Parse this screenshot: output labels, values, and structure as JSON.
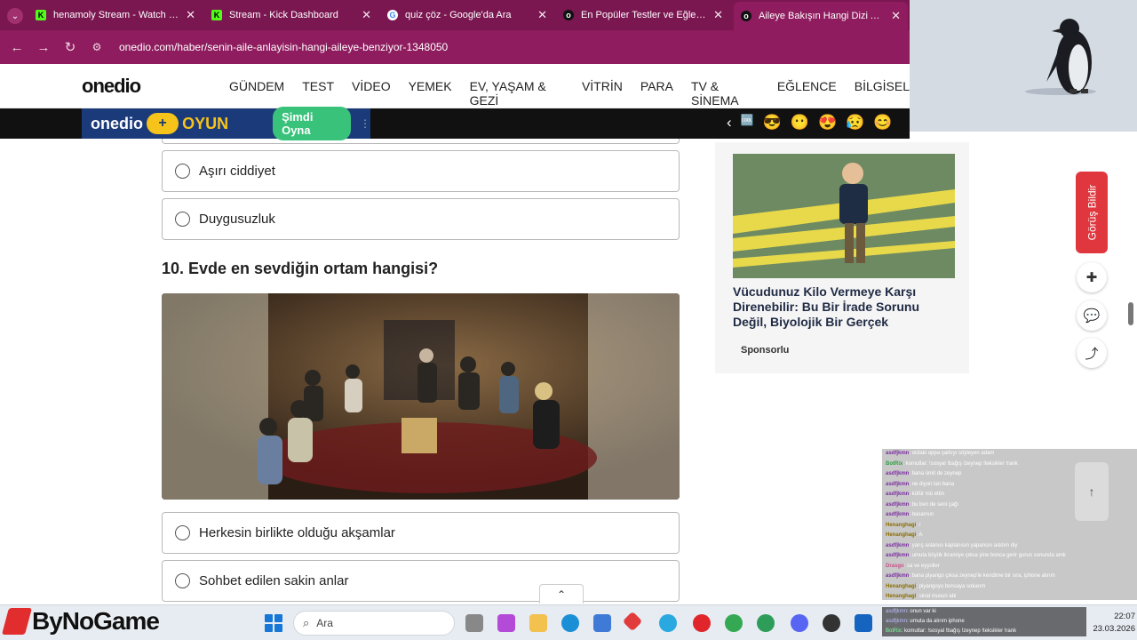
{
  "browser": {
    "tabs": [
      {
        "title": "henamoly Stream - Watch Live",
        "favicon": "K",
        "color": "#53fc18",
        "active": false
      },
      {
        "title": "Stream - Kick Dashboard",
        "favicon": "K",
        "color": "#53fc18",
        "active": false
      },
      {
        "title": "quiz çöz - Google'da Ara",
        "favicon": "G",
        "color": "#ffffff",
        "active": false
      },
      {
        "title": "En Popüler Testler ve Eğlenceli",
        "favicon": "o",
        "color": "#111111",
        "active": false
      },
      {
        "title": "Aileye Bakışın Hangi Dizi Ailesin",
        "favicon": "o",
        "color": "#111111",
        "active": true
      }
    ],
    "url": "onedio.com/haber/senin-aile-anlayisin-hangi-aileye-benziyor-1348050",
    "theme_color": "#8e1c5e"
  },
  "site": {
    "logo": "onedio",
    "nav": [
      "GÜNDEM",
      "TEST",
      "VİDEO",
      "YEMEK",
      "EV, YAŞAM & GEZİ",
      "VİTRİN",
      "PARA",
      "TV & SİNEMA",
      "EĞLENCE",
      "BİLGİSEL"
    ]
  },
  "game_strip": {
    "logo": "onedio",
    "label": "OYUN",
    "play_button": "Şimdi Oyna",
    "emojis": [
      "‹",
      "🆒",
      "😎",
      "😶",
      "😍",
      "😥",
      "😊"
    ]
  },
  "quiz": {
    "prev_options": [
      "Aşırı ciddiyet",
      "Duygusuzluk"
    ],
    "question": "10. Evde en sevdiğin ortam hangisi?",
    "options": [
      "Herkesin birlikte olduğu akşamlar",
      "Sohbet edilen sakin anlar"
    ]
  },
  "ad": {
    "title": "Vücudunuz Kilo Vermeye Karşı Direnebilir: Bu Bir İrade Sorunu Değil, Biyolojik Bir Gerçek",
    "label": "Sponsorlu"
  },
  "sidebar": {
    "feedback": "Görüş Bildir"
  },
  "chat": {
    "lines": [
      {
        "user": "asdfjkmn",
        "text": "ordaki oppa şarkıyı söyleyen adam"
      },
      {
        "user": "BotRix",
        "text": "komutlar: !sosyal !bağış !zeynep !teksikler !rank"
      },
      {
        "user": "asdfjkmn",
        "text": "bana ümit de zeynep"
      },
      {
        "user": "asdfjkmn",
        "text": "ne diyon lan bana"
      },
      {
        "user": "asdfjkmn",
        "text": "küfür mü ettin"
      },
      {
        "user": "asdfjkmn",
        "text": "bu ben de seni çağı"
      },
      {
        "user": "asdfjkmn",
        "text": "basarısın"
      },
      {
        "user": "Henanghagi",
        "text": "/"
      },
      {
        "user": "Henanghagi",
        "text": "A"
      },
      {
        "user": "asdfjkmn",
        "text": "yarış aslanısı kaplanısın yapansın asklım diy"
      },
      {
        "user": "asdfjkmn",
        "text": "umuta büyük ikramiye çıksa yine bonca gerir gurun sonunda amk"
      },
      {
        "user": "Drasgo",
        "text": "sa ve eyyoller"
      },
      {
        "user": "asdfjkmn",
        "text": "bana piyango çıksa zeynep'le kendime bir sıra, iphone alırım"
      },
      {
        "user": "Henanghagi",
        "text": "piyangoyu bonsaya sokarım"
      },
      {
        "user": "Henanghagi",
        "text": "sinal musun abi"
      }
    ],
    "bottom_lines": [
      {
        "user": "asdfjkmn",
        "text": "onun var ki"
      },
      {
        "user": "asdfjkmn",
        "text": "umuta da alırım iphone"
      },
      {
        "user": "BotRix",
        "text": "komutlar: !sosyal !bağış !zeynep !teksikler !rank"
      }
    ]
  },
  "taskbar": {
    "search_placeholder": "Ara",
    "time": "22:07",
    "date": "23.03.2026",
    "watermark": "ByNoGame"
  }
}
